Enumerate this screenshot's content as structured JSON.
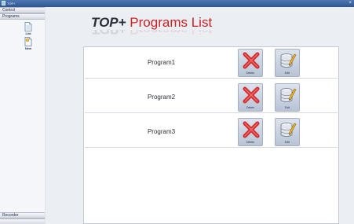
{
  "window": {
    "title": "TOP+",
    "close_glyph": "×"
  },
  "sidebar": {
    "sections": [
      {
        "label": "Control"
      },
      {
        "label": "Programs"
      }
    ],
    "items": [
      {
        "label": "List",
        "icon": "document-icon"
      },
      {
        "label": "New",
        "icon": "new-document-icon"
      }
    ],
    "bottom_sections": [
      {
        "label": "Recorder"
      }
    ]
  },
  "header": {
    "brand": "TOP+",
    "title": " Programs List"
  },
  "programs": [
    {
      "name": "Program1",
      "delete_label": "Delete",
      "edit_label": "Edit"
    },
    {
      "name": "Program2",
      "delete_label": "Delete",
      "edit_label": "Edit"
    },
    {
      "name": "Program3",
      "delete_label": "Delete",
      "edit_label": "Edit"
    }
  ],
  "colors": {
    "title_red": "#cc2222",
    "brand_dark": "#2a2f38",
    "accent_blue": "#2e5590"
  }
}
